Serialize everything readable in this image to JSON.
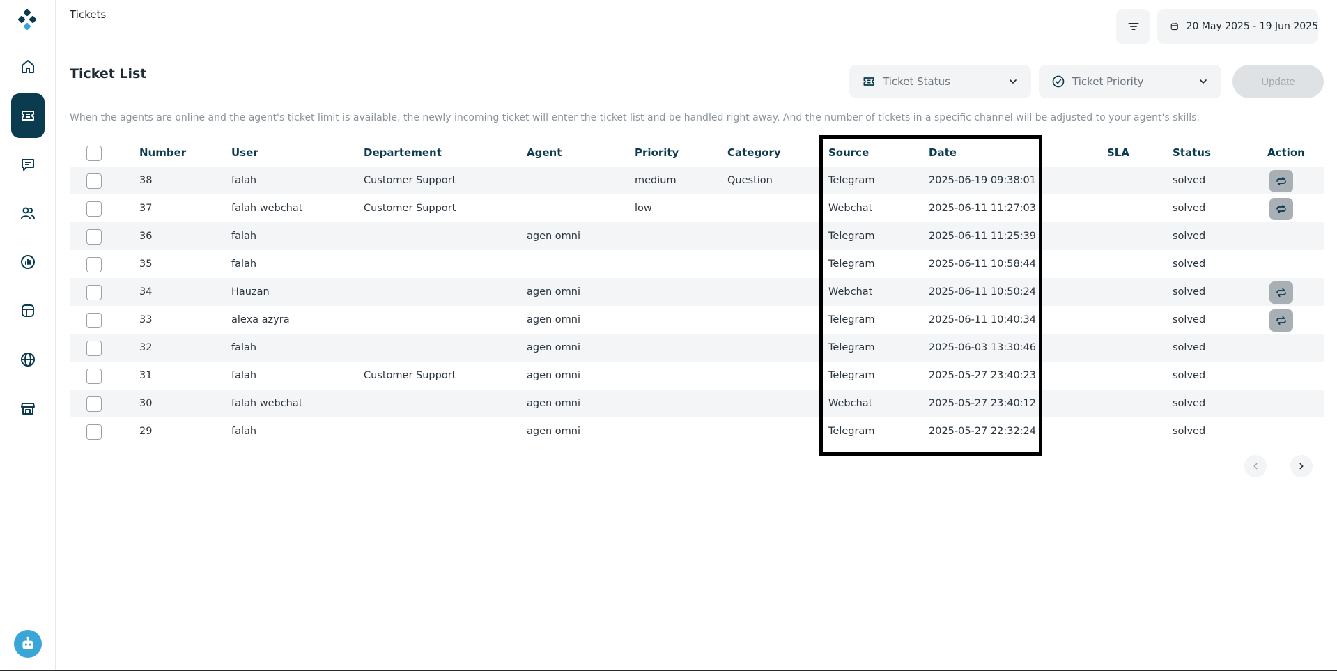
{
  "header": {
    "title": "Tickets",
    "date_range": "20 May 2025 - 19 Jun 2025"
  },
  "section": {
    "title": "Ticket List",
    "info": "When the agents are online and the agent's ticket limit is available, the newly incoming ticket will enter the ticket list and be handled right away. And the number of tickets in a specific channel will be adjusted to your agent's skills."
  },
  "filters": {
    "status_placeholder": "Ticket Status",
    "priority_placeholder": "Ticket Priority",
    "update_label": "Update"
  },
  "table": {
    "columns": {
      "number": "Number",
      "user": "User",
      "department": "Departement",
      "agent": "Agent",
      "priority": "Priority",
      "category": "Category",
      "source": "Source",
      "date": "Date",
      "sla": "SLA",
      "status": "Status",
      "action": "Action"
    },
    "rows": [
      {
        "number": "38",
        "user": "falah",
        "department": "Customer Support",
        "agent": "",
        "priority": "medium",
        "category": "Question",
        "source": "Telegram",
        "date": "2025-06-19 09:38:01",
        "sla": "",
        "status": "solved"
      },
      {
        "number": "37",
        "user": "falah webchat",
        "department": "Customer Support",
        "agent": "",
        "priority": "low",
        "category": "",
        "source": "Webchat",
        "date": "2025-06-11 11:27:03",
        "sla": "",
        "status": "solved"
      },
      {
        "number": "36",
        "user": "falah",
        "department": "",
        "agent": "agen omni",
        "priority": "",
        "category": "",
        "source": "Telegram",
        "date": "2025-06-11 11:25:39",
        "sla": "",
        "status": "solved"
      },
      {
        "number": "35",
        "user": "falah",
        "department": "",
        "agent": "",
        "priority": "",
        "category": "",
        "source": "Telegram",
        "date": "2025-06-11 10:58:44",
        "sla": "",
        "status": "solved"
      },
      {
        "number": "34",
        "user": "Hauzan",
        "department": "",
        "agent": "agen omni",
        "priority": "",
        "category": "",
        "source": "Webchat",
        "date": "2025-06-11 10:50:24",
        "sla": "",
        "status": "solved"
      },
      {
        "number": "33",
        "user": "alexa azyra",
        "department": "",
        "agent": "agen omni",
        "priority": "",
        "category": "",
        "source": "Telegram",
        "date": "2025-06-11 10:40:34",
        "sla": "",
        "status": "solved"
      },
      {
        "number": "32",
        "user": "falah",
        "department": "",
        "agent": "agen omni",
        "priority": "",
        "category": "",
        "source": "Telegram",
        "date": "2025-06-03 13:30:46",
        "sla": "",
        "status": "solved"
      },
      {
        "number": "31",
        "user": "falah",
        "department": "Customer Support",
        "agent": "agen omni",
        "priority": "",
        "category": "",
        "source": "Telegram",
        "date": "2025-05-27 23:40:23",
        "sla": "",
        "status": "solved"
      },
      {
        "number": "30",
        "user": "falah webchat",
        "department": "",
        "agent": "agen omni",
        "priority": "",
        "category": "",
        "source": "Webchat",
        "date": "2025-05-27 23:40:12",
        "sla": "",
        "status": "solved"
      },
      {
        "number": "29",
        "user": "falah",
        "department": "",
        "agent": "agen omni",
        "priority": "",
        "category": "",
        "source": "Telegram",
        "date": "2025-05-27 22:32:24",
        "sla": "",
        "status": "solved"
      }
    ],
    "action_rows": [
      0,
      1,
      4,
      5
    ]
  },
  "icons": {
    "logo": "brand-logo-icon",
    "home": "home-icon",
    "tickets": "ticket-icon",
    "chat": "chat-icon",
    "users": "users-icon",
    "reports": "report-icon",
    "templates": "template-icon",
    "web": "globe-icon",
    "store": "store-icon",
    "filter": "filter-icon",
    "calendar": "calendar-icon",
    "action": "reassign-icon"
  },
  "colors": {
    "primary": "#0b3b4f",
    "accent": "#3aa6d8",
    "row_alt": "#f4f5f6"
  }
}
